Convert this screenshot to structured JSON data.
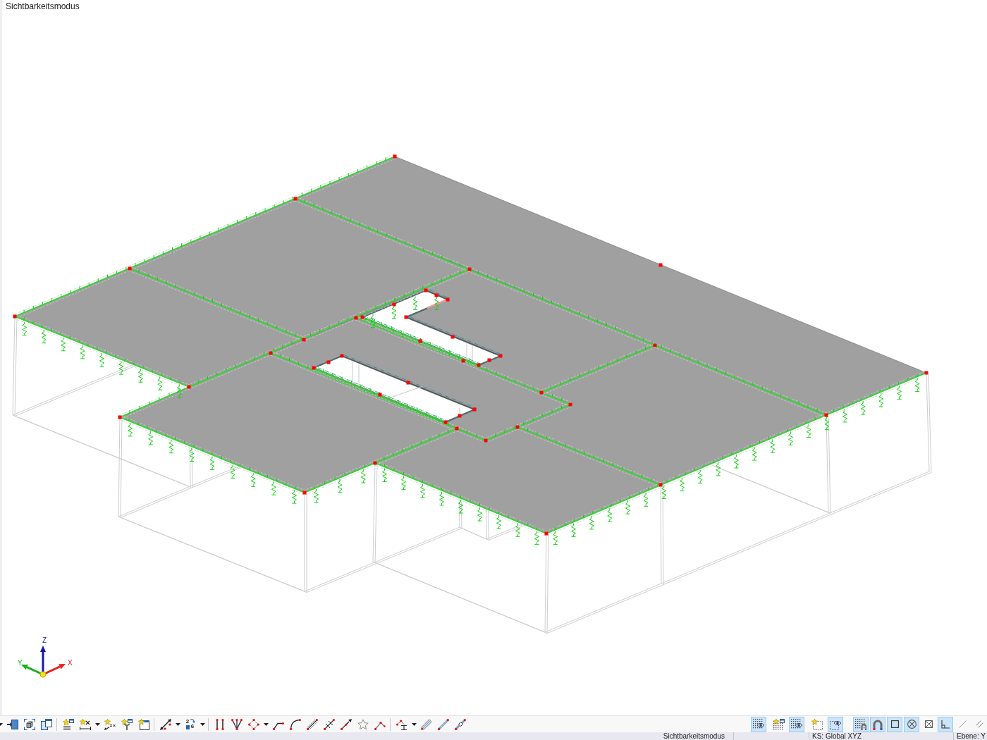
{
  "viewport": {
    "title": "Sichtbarkeitsmodus",
    "axes": [
      {
        "kind": "z",
        "label": "Z",
        "color": "#1616a8"
      },
      {
        "kind": "y",
        "label": "Y",
        "color": "#18b018"
      },
      {
        "kind": "x",
        "label": "X",
        "color": "#e82020"
      }
    ]
  },
  "toolbar": {
    "numbering_digits": [
      "2",
      "6"
    ],
    "view_toggles": [
      {
        "selected": true
      },
      {
        "selected": false
      },
      {
        "selected": true
      },
      {
        "selected": false
      },
      {
        "selected": true
      }
    ],
    "snap_toggles": [
      {
        "selected": true
      },
      {
        "selected": true
      },
      {
        "selected": true
      },
      {
        "selected": true
      },
      {
        "selected": false
      },
      {
        "selected": true
      },
      {
        "selected": false
      },
      {
        "selected": false
      }
    ]
  },
  "status_bar": {
    "mode": "Sichtbarkeitsmodus",
    "coordinate_system": "KS: Global XYZ",
    "plane": "Ebene: Y"
  }
}
